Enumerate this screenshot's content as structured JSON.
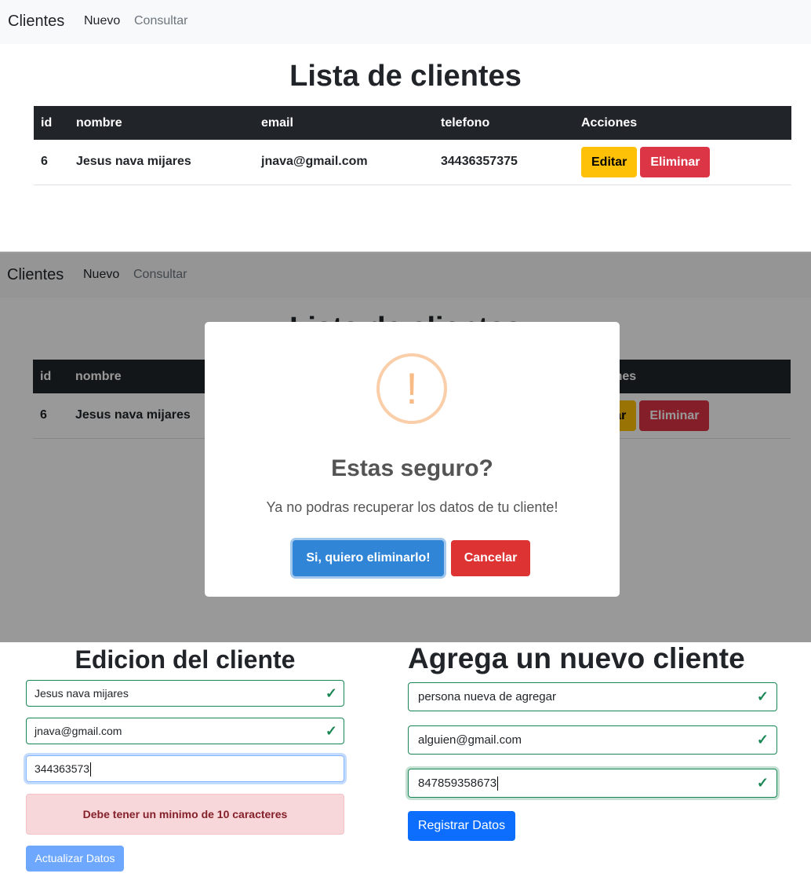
{
  "nav": {
    "brand": "Clientes",
    "new_link": "Nuevo",
    "consult_link": "Consultar"
  },
  "list": {
    "title": "Lista de clientes",
    "columns": [
      "id",
      "nombre",
      "email",
      "telefono",
      "Acciones"
    ],
    "rows": [
      {
        "id": "6",
        "nombre": "Jesus nava mijares",
        "email": "jnava@gmail.com",
        "telefono": "34436357375"
      }
    ],
    "edit_label": "Editar",
    "delete_label": "Eliminar"
  },
  "modal": {
    "icon_glyph": "!",
    "title": "Estas seguro?",
    "text": "Ya no podras recuperar los datos de tu cliente!",
    "confirm_label": "Si, quiero eliminarlo!",
    "cancel_label": "Cancelar"
  },
  "edit_form": {
    "title": "Edicion del cliente",
    "name_value": "Jesus nava mijares",
    "email_value": "jnava@gmail.com",
    "phone_value": "344363573",
    "error_text": "Debe tener un minimo de 10 caracteres",
    "submit_label": "Actualizar Datos"
  },
  "new_form": {
    "title": "Agrega un nuevo cliente",
    "name_value": "persona nueva de agregar",
    "email_value": "alguien@gmail.com",
    "phone_value": "847859358673",
    "submit_label": "Registrar Datos"
  },
  "icons": {
    "valid": "check-icon",
    "warning": "warning-icon"
  },
  "colors": {
    "warning_button": "#ffc107",
    "danger_button": "#dc3545",
    "confirm_button": "#3085d6",
    "valid_border": "#198754",
    "primary": "#0d6efd"
  }
}
